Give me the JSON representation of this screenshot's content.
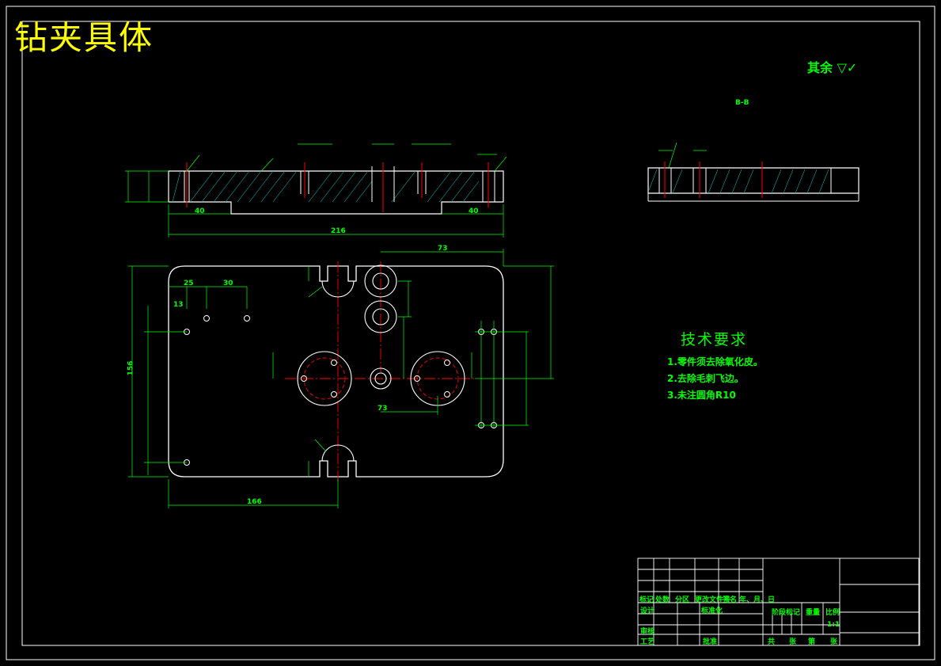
{
  "drawing": {
    "title": "钻夹具体",
    "roughness_note": "其余",
    "section_label": "B-B",
    "technical_requirements": {
      "title": "技术要求",
      "items": [
        "1.零件须去除氧化皮。",
        "2.去除毛刺飞边。",
        "3.未注圆角R10"
      ]
    },
    "dimensions": {
      "overall_length": "216",
      "left_step": "40",
      "right_step": "40",
      "plan_bottom": "166",
      "plan_height": "156",
      "dim_73_top": "73",
      "dim_73_mid": "73",
      "dim_25": "25",
      "dim_30": "30",
      "dim_13": "13"
    },
    "colors": {
      "outline": "#ffffff",
      "dimension": "#00ff00",
      "center": "#ff0000",
      "hatch": "#00aaaa",
      "title": "#ffff00"
    }
  },
  "title_block": {
    "row_headers": [
      "标记",
      "处数",
      "分区",
      "更改文件号",
      "签名",
      "年、月、日"
    ],
    "design": "设计",
    "standardize": "标准化",
    "stage_mark": "阶段标记",
    "weight": "重量",
    "scale_label": "比例",
    "scale": "1:1",
    "review": "审核",
    "process": "工艺",
    "approve": "批准",
    "total": "共",
    "sheet": "张",
    "page": "第",
    "page_end": "张"
  }
}
